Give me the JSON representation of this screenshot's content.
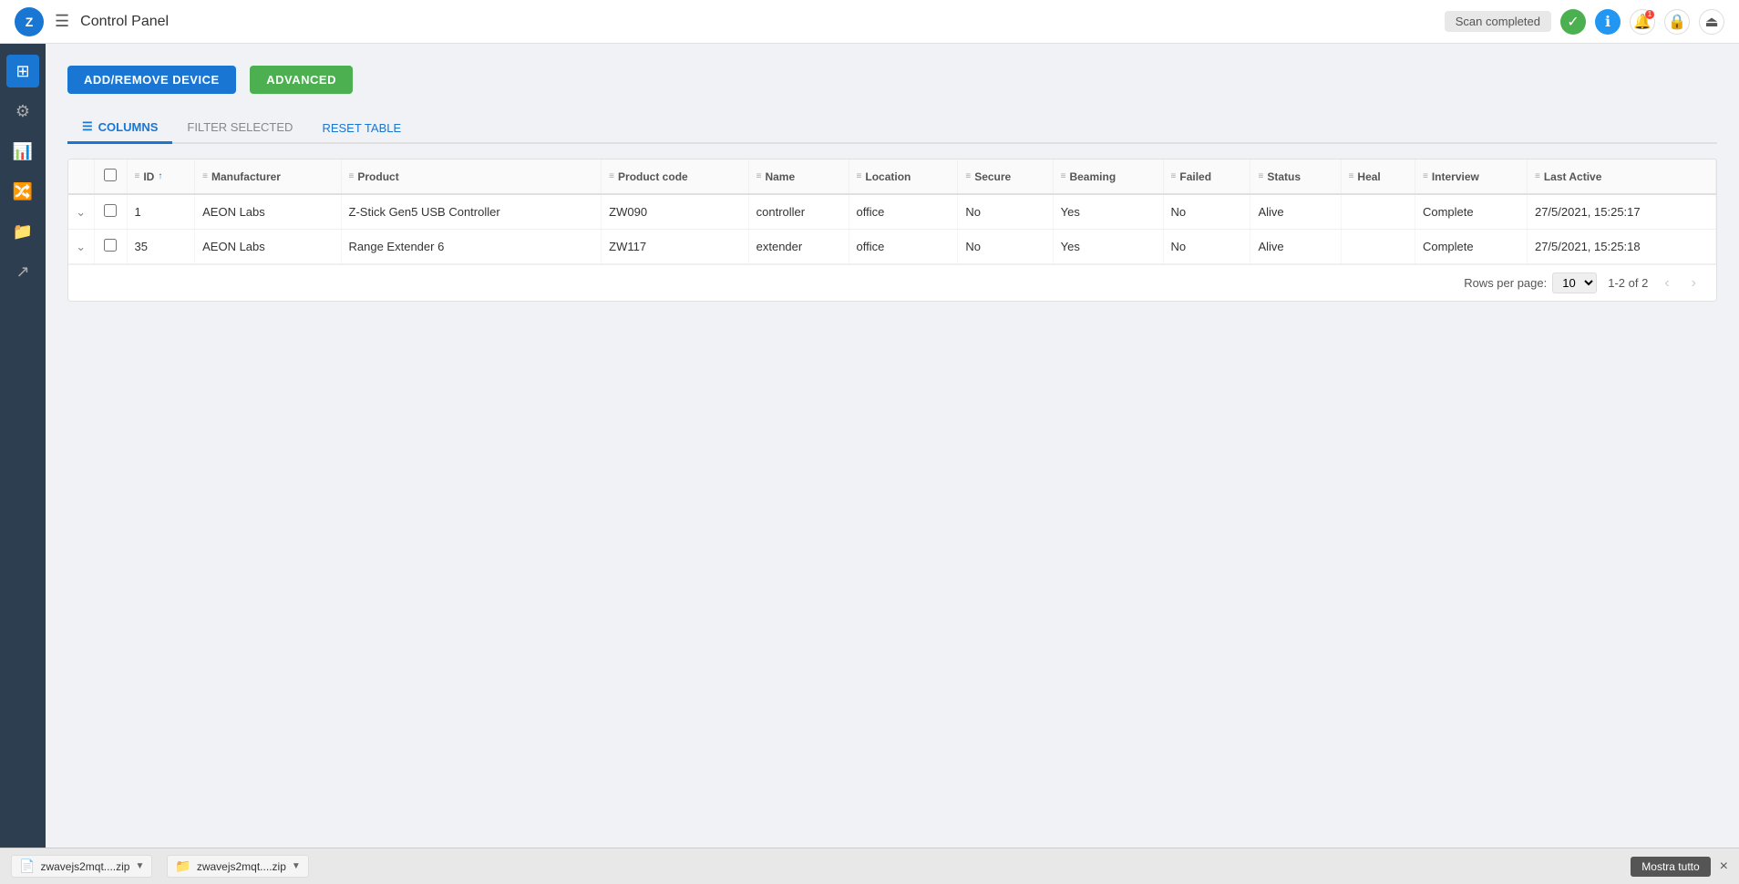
{
  "topbar": {
    "logo_text": "Z",
    "menu_icon": "☰",
    "title": "Control Panel",
    "scan_label": "Scan completed",
    "icons": {
      "check": "✓",
      "info": "ℹ",
      "bell": "🔔",
      "lock": "🔒",
      "exit": "⏏"
    },
    "notif_count": "1"
  },
  "sidebar": {
    "items": [
      {
        "icon": "⊞",
        "label": "dashboard",
        "active": true
      },
      {
        "icon": "⚙",
        "label": "settings",
        "active": false
      },
      {
        "icon": "📊",
        "label": "analytics",
        "active": false
      },
      {
        "icon": "🔀",
        "label": "flows",
        "active": false
      },
      {
        "icon": "📁",
        "label": "files",
        "active": false
      },
      {
        "icon": "↗",
        "label": "share",
        "active": false
      }
    ]
  },
  "buttons": {
    "add_remove": "ADD/REMOVE DEVICE",
    "advanced": "ADVANCED"
  },
  "toolbar": {
    "columns_label": "COLUMNS",
    "filter_label": "FILTER SELECTED",
    "reset_label": "RESET TABLE"
  },
  "table": {
    "columns": [
      {
        "key": "id",
        "label": "ID",
        "sortable": true
      },
      {
        "key": "manufacturer",
        "label": "Manufacturer",
        "filterable": true
      },
      {
        "key": "product",
        "label": "Product",
        "filterable": true
      },
      {
        "key": "product_code",
        "label": "Product code",
        "filterable": true
      },
      {
        "key": "name",
        "label": "Name",
        "filterable": true
      },
      {
        "key": "location",
        "label": "Location",
        "filterable": true
      },
      {
        "key": "secure",
        "label": "Secure",
        "filterable": true
      },
      {
        "key": "beaming",
        "label": "Beaming",
        "filterable": true
      },
      {
        "key": "failed",
        "label": "Failed",
        "filterable": true
      },
      {
        "key": "status",
        "label": "Status",
        "filterable": true
      },
      {
        "key": "heal",
        "label": "Heal",
        "filterable": true
      },
      {
        "key": "interview",
        "label": "Interview",
        "filterable": true
      },
      {
        "key": "last_active",
        "label": "Last Active",
        "filterable": true
      }
    ],
    "rows": [
      {
        "id": "1",
        "manufacturer": "AEON Labs",
        "product": "Z-Stick Gen5 USB Controller",
        "product_code": "ZW090",
        "name": "controller",
        "location": "office",
        "secure": "No",
        "beaming": "Yes",
        "failed": "No",
        "status": "Alive",
        "heal": "",
        "interview": "Complete",
        "last_active": "27/5/2021, 15:25:17"
      },
      {
        "id": "35",
        "manufacturer": "AEON Labs",
        "product": "Range Extender 6",
        "product_code": "ZW117",
        "name": "extender",
        "location": "office",
        "secure": "No",
        "beaming": "Yes",
        "failed": "No",
        "status": "Alive",
        "heal": "",
        "interview": "Complete",
        "last_active": "27/5/2021, 15:25:18"
      }
    ]
  },
  "pagination": {
    "rows_per_page_label": "Rows per page:",
    "rows_per_page_value": "10",
    "page_info": "1-2 of 2"
  },
  "bottombar": {
    "file1_name": "zwavejs2mqt....zip",
    "file2_name": "zwavejs2mqt....zip",
    "mostra_label": "Mostra tutto",
    "close_label": "×"
  }
}
